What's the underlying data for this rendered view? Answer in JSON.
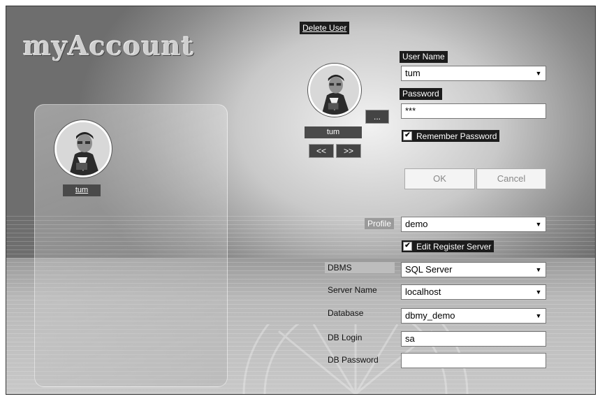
{
  "app": {
    "title": "myAccount"
  },
  "actions": {
    "delete_user": "Delete User",
    "browse": "...",
    "prev": "<<",
    "next": ">>",
    "ok": "OK",
    "cancel": "Cancel"
  },
  "selected_user": {
    "name": "tum"
  },
  "login": {
    "user_name_label": "User Name",
    "user_name_value": "tum",
    "password_label": "Password",
    "password_value": "***",
    "remember_password_label": "Remember Password",
    "remember_password_checked": true
  },
  "profile": {
    "label": "Profile",
    "value": "demo",
    "edit_register_server_label": "Edit Register Server",
    "edit_register_server_checked": true
  },
  "server": {
    "dbms_label": "DBMS",
    "dbms_value": "SQL Server",
    "server_name_label": "Server Name",
    "server_name_value": "localhost",
    "database_label": "Database",
    "database_value": "dbmy_demo",
    "db_login_label": "DB Login",
    "db_login_value": "sa",
    "db_password_label": "DB Password",
    "db_password_value": ""
  },
  "icons": {
    "dropdown": "chevron-down-icon",
    "checkbox": "check-icon",
    "avatar": "user-avatar-photo"
  },
  "colors": {
    "label_bg": "#1c1c1c",
    "tag_bg": "#4a4a4a",
    "window_bg": "#c9c9c9"
  }
}
